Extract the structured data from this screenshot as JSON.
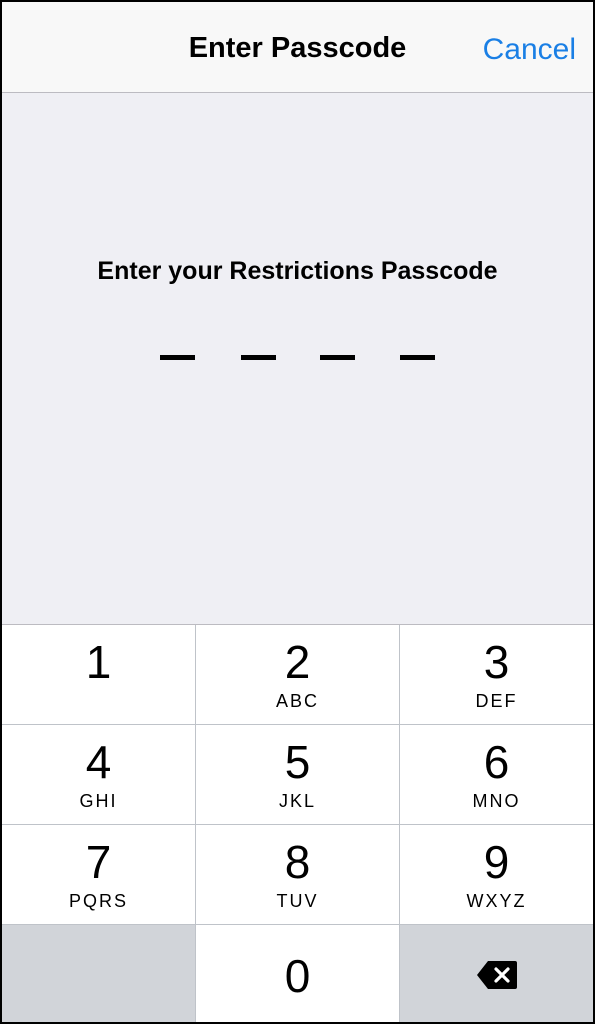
{
  "navbar": {
    "title": "Enter Passcode",
    "cancel_label": "Cancel"
  },
  "prompt": "Enter your Restrictions Passcode",
  "passcode": {
    "length": 4,
    "entered": 0
  },
  "keypad": {
    "keys": [
      {
        "digit": "1",
        "letters": ""
      },
      {
        "digit": "2",
        "letters": "ABC"
      },
      {
        "digit": "3",
        "letters": "DEF"
      },
      {
        "digit": "4",
        "letters": "GHI"
      },
      {
        "digit": "5",
        "letters": "JKL"
      },
      {
        "digit": "6",
        "letters": "MNO"
      },
      {
        "digit": "7",
        "letters": "PQRS"
      },
      {
        "digit": "8",
        "letters": "TUV"
      },
      {
        "digit": "9",
        "letters": "WXYZ"
      },
      {
        "digit": "0",
        "letters": ""
      }
    ],
    "delete_icon": "backspace-icon"
  },
  "colors": {
    "accent": "#1a7fe5",
    "background": "#efeff4",
    "keypad_gray": "#d1d4d9"
  }
}
